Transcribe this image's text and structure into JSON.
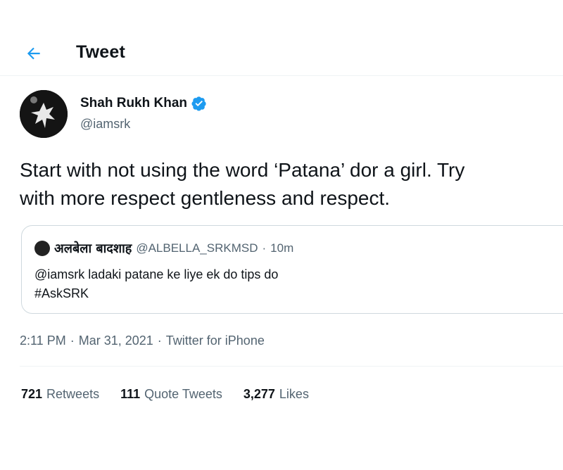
{
  "header": {
    "title": "Tweet",
    "back_icon": "arrow-left-icon",
    "accent": "#1d9bf0"
  },
  "author": {
    "display_name": "Shah Rukh Khan",
    "handle": "@iamsrk",
    "verified_icon": "verified-badge-icon"
  },
  "tweet": {
    "line1": "Start with not using the word ‘Patana’ dor a girl. Try",
    "line2": "with more respect gentleness and respect."
  },
  "quote": {
    "name": "अलबेला बादशाह",
    "handle": "@ALBELLA_SRKMSD",
    "separator": "·",
    "time": "10m",
    "line1": "@iamsrk ladaki patane ke liye ek do tips do",
    "line2": "#AskSRK"
  },
  "meta": {
    "time": "2:11 PM",
    "sep1": "·",
    "date": "Mar 31, 2021",
    "sep2": "·",
    "source": "Twitter for iPhone"
  },
  "stats": [
    {
      "count": "721",
      "label": "Retweets"
    },
    {
      "count": "111",
      "label": "Quote Tweets"
    },
    {
      "count": "3,277",
      "label": "Likes"
    }
  ]
}
